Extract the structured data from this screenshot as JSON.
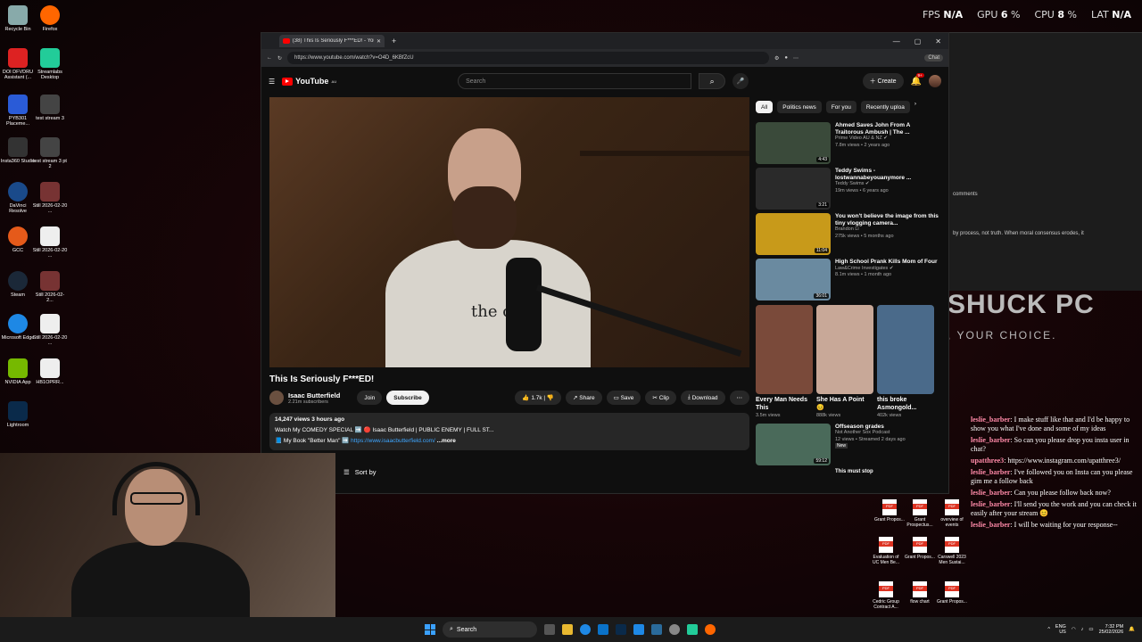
{
  "desktop_icons": [
    {
      "label": "Recycle Bin",
      "color": "#8aa"
    },
    {
      "label": "Firefox",
      "color": "#f60"
    },
    {
      "label": "DOI DFVDRU Assistant (...",
      "color": "#d22"
    },
    {
      "label": "Streamlabs Desktop",
      "color": "#2c9"
    },
    {
      "label": "PYB301 Placeme...",
      "color": "#2a5bd7"
    },
    {
      "label": "test stream 3",
      "color": "#444"
    },
    {
      "label": "Insta360 Studio",
      "color": "#333"
    },
    {
      "label": "test stream 3 pt 2",
      "color": "#444"
    },
    {
      "label": "DaVinci Resolve",
      "color": "#1a4a8a"
    },
    {
      "label": "Still 2026-02-20 ...",
      "color": "#733"
    },
    {
      "label": "GCC",
      "color": "#e55a1a"
    },
    {
      "label": "Still 2026-02-20 ...",
      "color": "#eee"
    },
    {
      "label": "Steam",
      "color": "#1b2838"
    },
    {
      "label": "Still 2026-02-2...",
      "color": "#733"
    },
    {
      "label": "Microsoft Edge",
      "color": "#1e88e5"
    },
    {
      "label": "Still 2026-02-20 ...",
      "color": "#eee"
    },
    {
      "label": "NVIDIA App",
      "color": "#76b900"
    },
    {
      "label": "HB1OPRR...",
      "color": "#eee"
    },
    {
      "label": "Lightroom",
      "color": "#0a2a4a"
    }
  ],
  "hud": {
    "fps_label": "FPS",
    "fps": "N/A",
    "gpu_label": "GPU",
    "gpu": "6",
    "cpu_label": "CPU",
    "cpu": "8",
    "lat_label": "LAT",
    "lat": "N/A",
    "pct": "%"
  },
  "bg_window": {
    "comments": "comments",
    "snippet": "by process, not truth. When moral consensus erodes, it",
    "banner": "SHUCK PC",
    "tagline": ", YOUR CHOICE."
  },
  "browser": {
    "tab_title": "(38) This Is Seriously F***ED! - You",
    "url": "https://www.youtube.com/watch?v=O4D_6KBfZcU",
    "chat_btn": "Chat"
  },
  "youtube": {
    "logo": "YouTube",
    "region": "AU",
    "search_placeholder": "Search",
    "create": "Create",
    "notif_count": "9+",
    "video_title": "This Is Seriously F***ED!",
    "video_text": "the c",
    "channel": "Isaac Butterfield",
    "subscribers": "2.21m subscribers",
    "join": "Join",
    "subscribe": "Subscribe",
    "likes": "1.7k",
    "share": "Share",
    "save": "Save",
    "clip": "Clip",
    "download": "Download",
    "desc_stats": "14,247 views  3 hours ago",
    "desc_line1": "Watch My COMEDY SPECIAL ➡️ 🔴 Isaac Butterfield | PUBLIC ENEMY | FULL ST...",
    "desc_line2_prefix": "📘 My Book \"Better Man\" ➡️",
    "desc_link": "https://www.isaacbutterfield.com/",
    "more": "...more",
    "sort_by": "Sort by",
    "chips": [
      "All",
      "Politics news",
      "For you",
      "Recently uploa"
    ],
    "recs": [
      {
        "title": "Ahmed Saves John From A Traitorous Ambush | The ...",
        "channel": "Prime Video AU & NZ ✔",
        "meta": "7.8m views • 2 years ago",
        "dur": "4:43",
        "color": "#3a4a3a"
      },
      {
        "title": "Teddy Swims - lostwannabeyouanymore ...",
        "channel": "Teddy Swims ✔",
        "meta": "19m views • 6 years ago",
        "dur": "3:21",
        "color": "#2a2a2a"
      },
      {
        "title": "You won't believe the image from this tiny vlogging camera...",
        "channel": "Brandon Li",
        "meta": "275k views • 5 months ago",
        "dur": "11:04",
        "color": "#c89a1a"
      },
      {
        "title": "High School Prank Kills Mom of Four",
        "channel": "Law&Crime Investigates ✔",
        "meta": "8.1m views • 1 month ago",
        "dur": "36:01",
        "color": "#6a8aa0"
      },
      {
        "title": "Offseason grades",
        "channel": "Not Another Sox Podcast",
        "meta": "12 views • Streamed 2 days ago",
        "badge": "New",
        "dur": "59:12",
        "color": "#4a6a5a"
      }
    ],
    "shorts": [
      {
        "title": "Every Man Needs This",
        "views": "3.5m views",
        "color": "#7a4a3a"
      },
      {
        "title": "She Has A Point 😣",
        "views": "888k views",
        "color": "#c8a898"
      },
      {
        "title": "this broke Asmongold...",
        "views": "402k views",
        "color": "#4a6a8a"
      }
    ],
    "next_hint": "This must stop"
  },
  "chat": [
    {
      "user": "leslie_barber",
      "msg": "I make stuff like that and I'd be happy to show you what I've done and some of my ideas"
    },
    {
      "user": "leslie_barber",
      "msg": "So can you please drop you insta user in chat?"
    },
    {
      "user": "upatthree3",
      "msg": "https://www.instagram.com/upatthree3/"
    },
    {
      "user": "leslie_barber",
      "msg": "I've followed you on Insta can you please gim me a follow back"
    },
    {
      "user": "leslie_barber",
      "msg": "Can you please follow back now?"
    },
    {
      "user": "leslie_barber",
      "msg": "I'll send you the work and you can check it easily after your stream 😊"
    },
    {
      "user": "leslie_barber",
      "msg": "I will be waiting for your response--"
    }
  ],
  "desk_files": [
    {
      "label": "Grant Propos..."
    },
    {
      "label": "Grant Prospectus..."
    },
    {
      "label": "overview of events"
    },
    {
      "label": "Evaluation of UC Men Be..."
    },
    {
      "label": "Grant Propos..."
    },
    {
      "label": "Carswell 2023 Men Sustai..."
    },
    {
      "label": "Cedric Group Contract A..."
    },
    {
      "label": "flow chart"
    },
    {
      "label": "Grant Propos..."
    }
  ],
  "taskbar": {
    "search": "Search",
    "lang": "ENG",
    "region": "US",
    "time": "7:32 PM",
    "date": "25/02/2026"
  }
}
